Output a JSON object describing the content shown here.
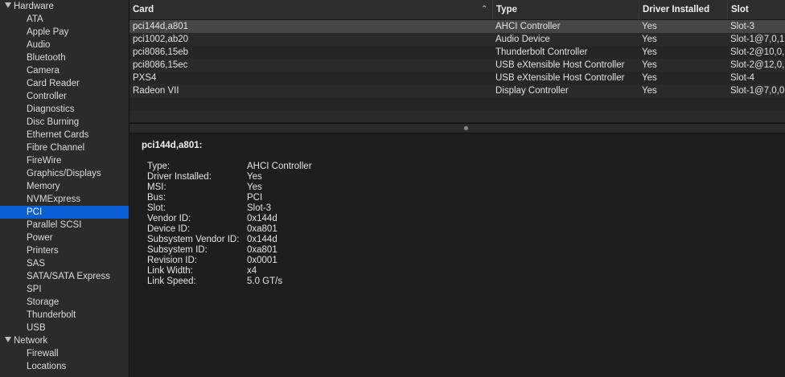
{
  "sidebar": {
    "groups": [
      {
        "label": "Hardware",
        "items": [
          "ATA",
          "Apple Pay",
          "Audio",
          "Bluetooth",
          "Camera",
          "Card Reader",
          "Controller",
          "Diagnostics",
          "Disc Burning",
          "Ethernet Cards",
          "Fibre Channel",
          "FireWire",
          "Graphics/Displays",
          "Memory",
          "NVMExpress",
          "PCI",
          "Parallel SCSI",
          "Power",
          "Printers",
          "SAS",
          "SATA/SATA Express",
          "SPI",
          "Storage",
          "Thunderbolt",
          "USB"
        ]
      },
      {
        "label": "Network",
        "items": [
          "Firewall",
          "Locations"
        ]
      }
    ],
    "selected": "PCI"
  },
  "table": {
    "headers": [
      "Card",
      "Type",
      "Driver Installed",
      "Slot"
    ],
    "sort_icon": "chevron-up-icon",
    "rows": [
      [
        "pci144d,a801",
        "AHCI Controller",
        "Yes",
        "Slot-3"
      ],
      [
        "pci1002,ab20",
        "Audio Device",
        "Yes",
        "Slot-1@7,0,1"
      ],
      [
        "pci8086,15eb",
        "Thunderbolt Controller",
        "Yes",
        "Slot-2@10,0,"
      ],
      [
        "pci8086,15ec",
        "USB eXtensible Host Controller",
        "Yes",
        "Slot-2@12,0,"
      ],
      [
        "PXS4",
        "USB eXtensible Host Controller",
        "Yes",
        "Slot-4"
      ],
      [
        "Radeon VII",
        "Display Controller",
        "Yes",
        "Slot-1@7,0,0"
      ]
    ],
    "selected_row": 0
  },
  "detail": {
    "title": "pci144d,a801:",
    "properties": [
      [
        "Type:",
        "AHCI Controller"
      ],
      [
        "Driver Installed:",
        "Yes"
      ],
      [
        "MSI:",
        "Yes"
      ],
      [
        "Bus:",
        "PCI"
      ],
      [
        "Slot:",
        "Slot-3"
      ],
      [
        "Vendor ID:",
        "0x144d"
      ],
      [
        "Device ID:",
        "0xa801"
      ],
      [
        "Subsystem Vendor ID:",
        "0x144d"
      ],
      [
        "Subsystem ID:",
        "0xa801"
      ],
      [
        "Revision ID:",
        "0x0001"
      ],
      [
        "Link Width:",
        "x4"
      ],
      [
        "Link Speed:",
        "5.0 GT/s"
      ]
    ]
  },
  "colors": {
    "selection": "#0a5fd6",
    "background": "#1e1e1e",
    "sidebar": "#2b2b2b"
  }
}
